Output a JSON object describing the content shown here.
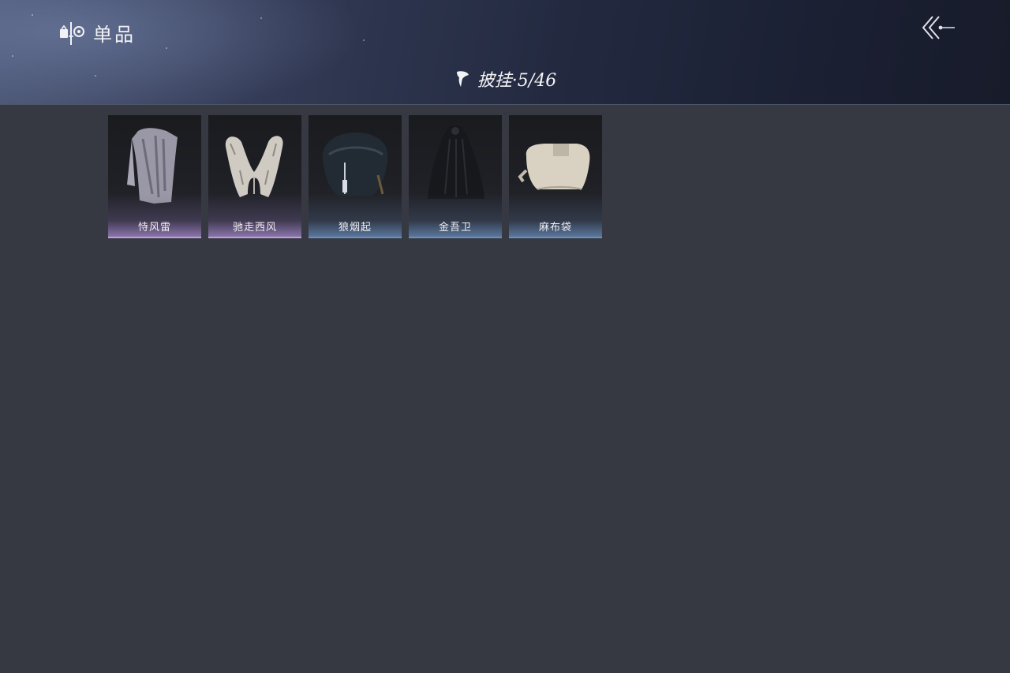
{
  "header": {
    "title": "单品",
    "category_label": "披挂·5/46"
  },
  "items": [
    {
      "name": "恃风雷",
      "rarity_color": "#b9a3d6"
    },
    {
      "name": "驰走西风",
      "rarity_color": "#b9a3d6"
    },
    {
      "name": "狼烟起",
      "rarity_color": "#6f8fb8"
    },
    {
      "name": "金吾卫",
      "rarity_color": "#6f8fb8"
    },
    {
      "name": "麻布袋",
      "rarity_color": "#6f8fb8"
    }
  ],
  "icons": {
    "brand": "collection-icon",
    "category": "cape-icon",
    "back": "back-arrow-icon"
  }
}
